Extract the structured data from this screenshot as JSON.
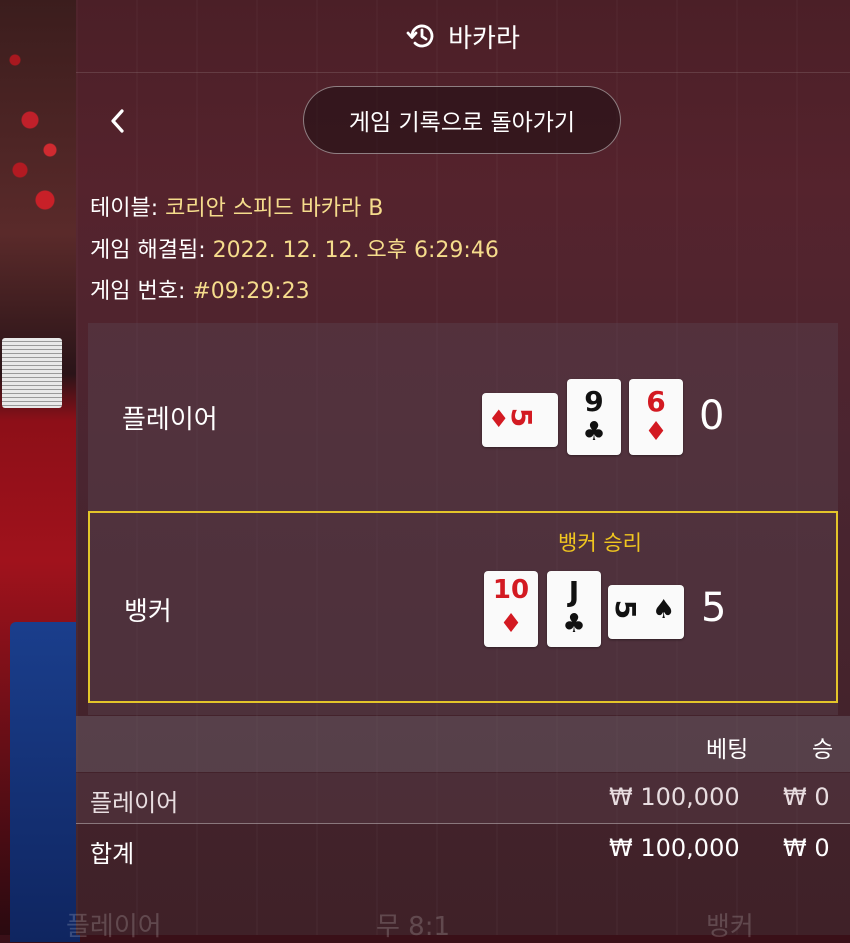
{
  "header": {
    "title": "바카라",
    "icon": "history-icon"
  },
  "nav": {
    "back_button_label": "게임 기록으로 돌아가기",
    "back_icon": "chevron-left-icon"
  },
  "info": {
    "table_label": "테이블:",
    "table_value": "코리안 스피드 바카라 B",
    "resolved_label": "게임 해결됨:",
    "resolved_value": "2022. 12. 12. 오후 6:29:46",
    "game_no_label": "게임 번호:",
    "game_no_value": "#09:29:23"
  },
  "player": {
    "label": "플레이어",
    "total": "0",
    "cards": [
      {
        "rank": "5",
        "suit": "♦",
        "color": "red",
        "rotated": true
      },
      {
        "rank": "9",
        "suit": "♣",
        "color": "black",
        "rotated": false
      },
      {
        "rank": "6",
        "suit": "♦",
        "color": "red",
        "rotated": false
      }
    ]
  },
  "banker": {
    "label": "뱅커",
    "total": "5",
    "win_text": "뱅커 승리",
    "cards": [
      {
        "rank": "10",
        "suit": "♦",
        "color": "red",
        "rotated": false
      },
      {
        "rank": "J",
        "suit": "♣",
        "color": "black",
        "rotated": false
      },
      {
        "rank": "5",
        "suit": "♠",
        "color": "black",
        "rotated": true
      }
    ]
  },
  "bets_table": {
    "headers": {
      "bet": "베팅",
      "win": "승"
    },
    "rows": [
      {
        "name": "플레이어",
        "bet": "₩ 100,000",
        "win": "₩ 0"
      },
      {
        "name": "합계",
        "bet": "₩ 100,000",
        "win": "₩ 0"
      }
    ]
  },
  "background_text": {
    "left": "플레이어",
    "mid": "무 8:1",
    "right": "뱅커"
  },
  "colors": {
    "win_highlight": "#e3c52a",
    "info_value": "#f5dc8c",
    "card_red": "#d31a22"
  }
}
